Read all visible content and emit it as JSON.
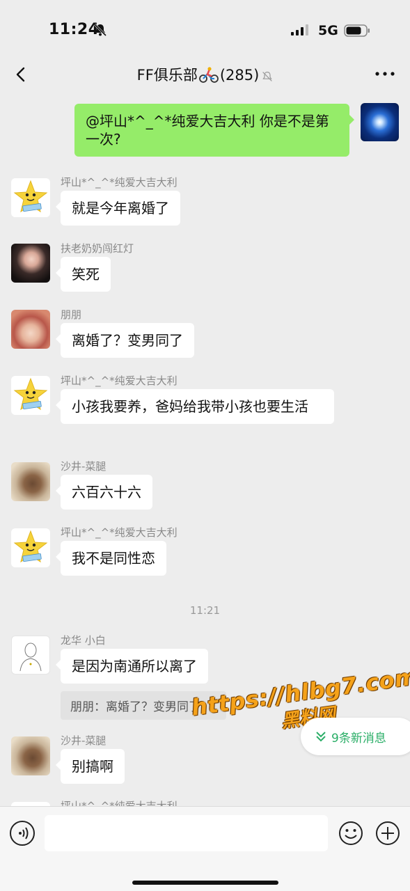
{
  "status_bar": {
    "time": "11:24",
    "network": "5G"
  },
  "nav": {
    "title_prefix": "FF俱乐部",
    "title_suffix": "(285)"
  },
  "messages": [
    {
      "sender": "",
      "text": "@坪山*^_^*纯爱大吉大利  你是不是第一次?",
      "self": true
    },
    {
      "sender": "坪山*^_^*纯爱大吉大利",
      "text": "就是今年离婚了"
    },
    {
      "sender": "扶老奶奶闯红灯",
      "text": "笑死"
    },
    {
      "sender": "朋朋",
      "text": "离婚了？变男同了"
    },
    {
      "sender": "坪山*^_^*纯爱大吉大利",
      "text": "小孩我要养，爸妈给我带小孩也要生活"
    },
    {
      "sender": "沙井-菜腿",
      "text": "六百六十六"
    },
    {
      "sender": "坪山*^_^*纯爱大吉大利",
      "text": "我不是同性恋"
    },
    {
      "sender": "龙华  小白",
      "text": "是因为南通所以离了",
      "quote": "朋朋：离婚了？变男同了"
    },
    {
      "sender": "沙井-菜腿",
      "text": "别搞啊"
    },
    {
      "sender": "坪山*^_^*纯爱大吉大利",
      "text": ""
    }
  ],
  "timestamp": "11:21",
  "watermark": {
    "url": "https://hlbg7.com",
    "text": "黑料网"
  },
  "new_messages": "9条新消息",
  "colors": {
    "self_bubble": "#95ec69",
    "accent": "#2aae67",
    "background": "#ededed"
  }
}
